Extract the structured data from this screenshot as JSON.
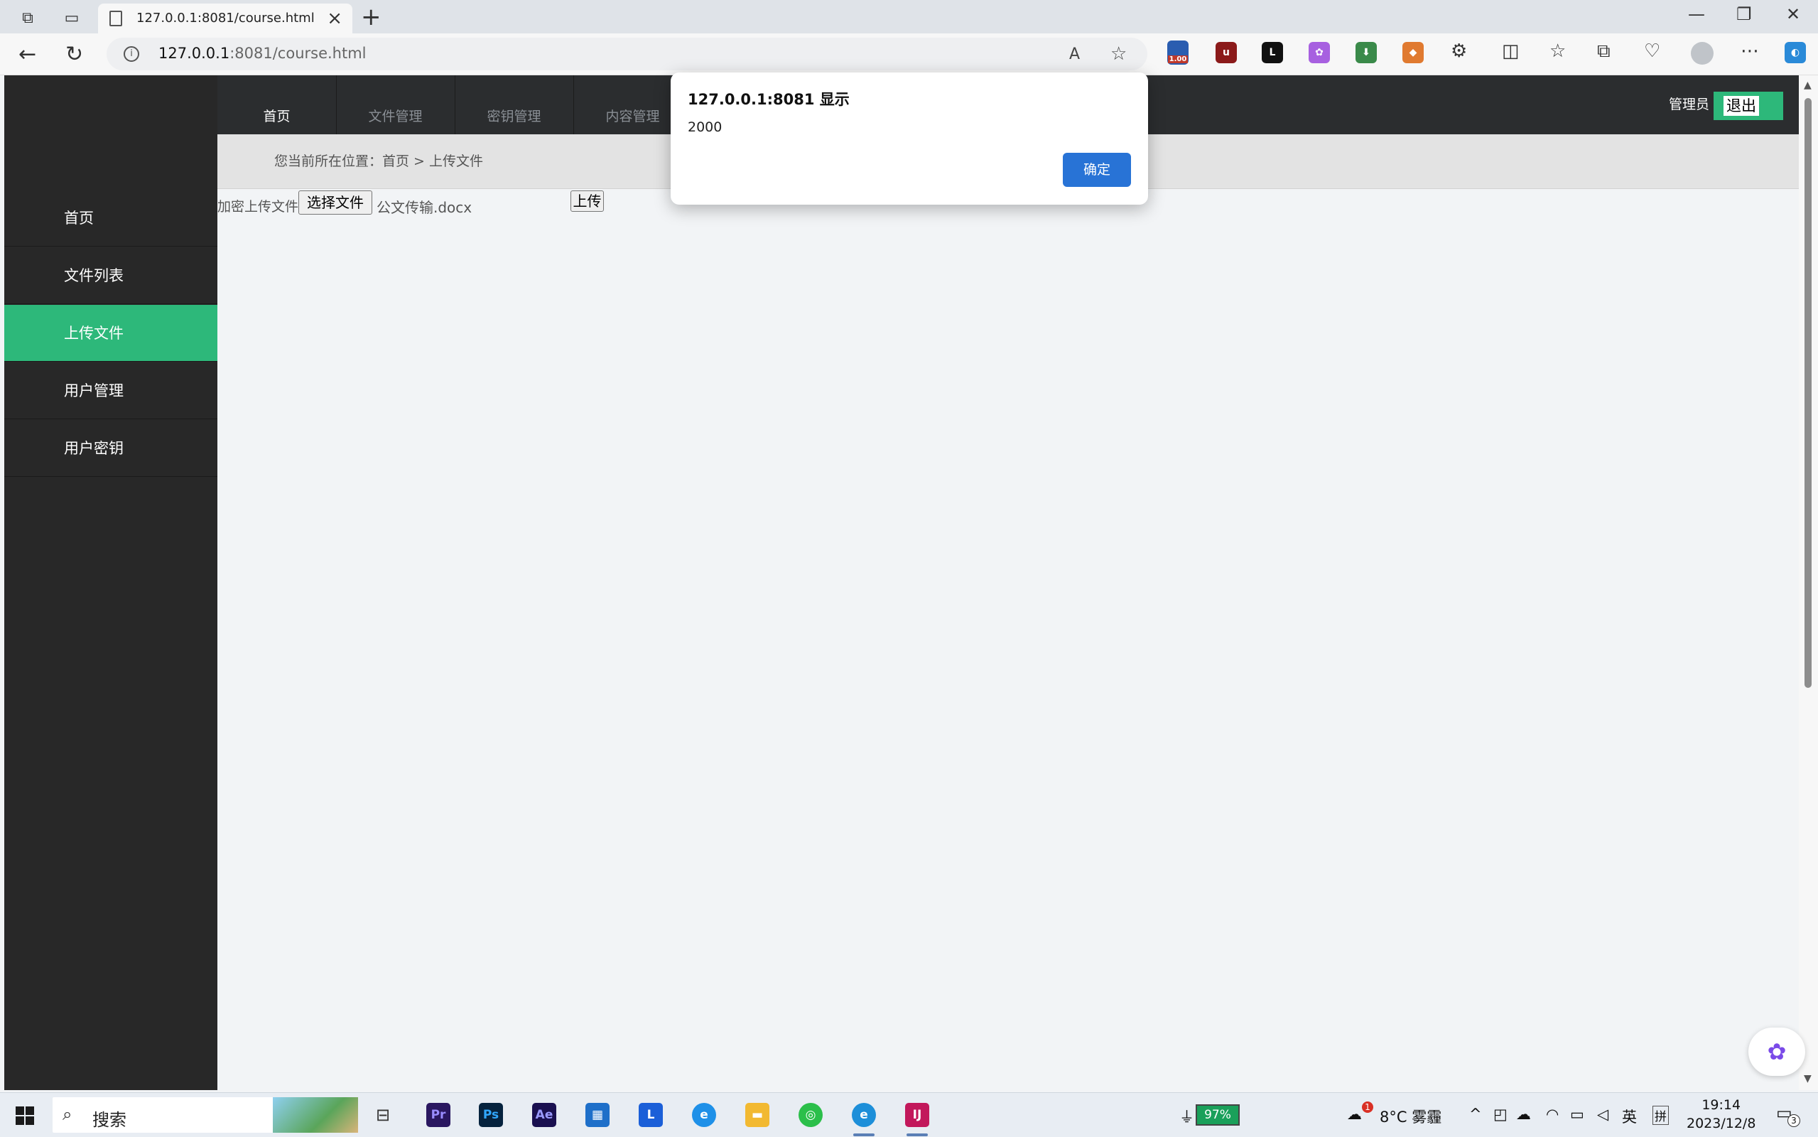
{
  "browser": {
    "tab_title": "127.0.0.1:8081/course.html",
    "url_host": "127.0.0.1",
    "url_rest": ":8081/course.html",
    "ext_badge": "1.00"
  },
  "topnav": {
    "items": [
      "首页",
      "文件管理",
      "密钥管理",
      "内容管理"
    ],
    "admin_label": "管理员",
    "logout_label": "退出"
  },
  "breadcrumb": "您当前所在位置：首页 > 上传文件",
  "sidebar": {
    "items": [
      "首页",
      "文件列表",
      "上传文件",
      "用户管理",
      "用户密钥"
    ]
  },
  "upload": {
    "label": "加密上传文件",
    "choose_label": "选择文件",
    "filename": "公文传输.docx",
    "upload_label": "上传"
  },
  "dialog": {
    "title": "127.0.0.1:8081 显示",
    "message": "2000",
    "ok_label": "确定"
  },
  "taskbar": {
    "search_placeholder": "搜索",
    "apps": [
      "Pr",
      "Ps",
      "Ae",
      "IJ"
    ],
    "battery": "97%",
    "weather": "8°C  雾霾",
    "weather_badge": "1",
    "ime": "英",
    "ime2": "拼",
    "time": "19:14",
    "date": "2023/12/8",
    "notify_count": "3"
  },
  "colors": {
    "accent_green": "#2db87a",
    "sidebar_bg": "#282828",
    "dialog_button": "#2873d6"
  }
}
